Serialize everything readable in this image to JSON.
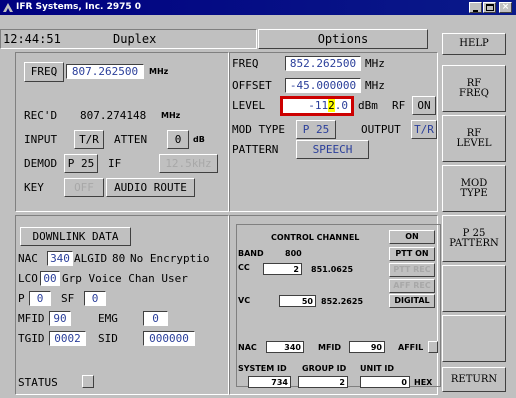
{
  "window": {
    "title": "IFR Systems, Inc. 2975 0",
    "controls": [
      "minimize-icon",
      "maximize-icon",
      "close-icon"
    ]
  },
  "header": {
    "time": "12:44:51",
    "mode": "Duplex",
    "options": "Options",
    "help": "HELP"
  },
  "side_buttons": [
    "RF\nFREQ",
    "RF\nLEVEL",
    "MOD\nTYPE",
    "P 25\nPATTERN",
    "",
    "",
    "RETURN"
  ],
  "left_panel": {
    "freq_label": "FREQ",
    "freq_value": "807.262500",
    "freq_unit": "MHz",
    "recd_label": "REC'D",
    "recd_value": "807.274148",
    "recd_unit": "MHz",
    "input_label": "INPUT",
    "input_value": "T/R",
    "atten_label": "ATTEN",
    "atten_value": "0",
    "atten_unit": "dB",
    "demod_label": "DEMOD",
    "demod_value": "P 25",
    "if_label": "IF",
    "if_value": "12.5kHz",
    "key_label": "KEY",
    "key_value": "OFF",
    "audio_route": "AUDIO ROUTE"
  },
  "right_panel": {
    "freq_label": "FREQ",
    "freq_value": "852.262500",
    "freq_unit": "MHz",
    "offset_label": "OFFSET",
    "offset_value": "-45.000000",
    "offset_unit": "MHz",
    "level_label": "LEVEL",
    "level_before": "-11",
    "level_cursor": "2",
    "level_after": ".0",
    "level_unit": "dBm",
    "rf_label": "RF",
    "rf_value": "ON",
    "modtype_label": "MOD TYPE",
    "modtype_value": "P 25",
    "output_label": "OUTPUT",
    "output_value": "T/R",
    "pattern_label": "PATTERN",
    "pattern_value": "SPEECH"
  },
  "downlink": {
    "title": "DOWNLINK DATA",
    "nac_label": "NAC",
    "nac_value": "340",
    "algid_label": "ALGID",
    "algid_value": "80",
    "algid_desc": "No Encryptio",
    "lco_label": "LCO",
    "lco_value": "00",
    "lco_desc": "Grp Voice Chan User",
    "p_label": "P",
    "p_value": "0",
    "sf_label": "SF",
    "sf_value": "0",
    "mfid_label": "MFID",
    "mfid_value": "90",
    "emg_label": "EMG",
    "emg_value": "0",
    "tgid_label": "TGID",
    "tgid_value": "0002",
    "sid_label": "SID",
    "sid_value": "000000",
    "status_label": "STATUS"
  },
  "control": {
    "title": "CONTROL CHANNEL",
    "state": "ON",
    "band_label": "BAND",
    "band_value": "800",
    "ptt_on": "PTT ON",
    "cc_label": "CC",
    "cc_value": "2",
    "cc_freq": "851.0625",
    "ptt_rec": "PTT REC",
    "aff_rec": "AFF REC",
    "vc_label": "VC",
    "vc_value": "50",
    "vc_freq": "852.2625",
    "digital": "DIGITAL",
    "nac_label": "NAC",
    "nac_value": "340",
    "mfid_label": "MFID",
    "mfid_value": "90",
    "affil_label": "AFFIL",
    "sysid_label": "SYSTEM ID",
    "sysid_value": "734",
    "groupid_label": "GROUP ID",
    "groupid_value": "2",
    "unitid_label": "UNIT ID",
    "unitid_value": "0",
    "hex": "HEX"
  },
  "colors": {
    "title_bar": "#000080",
    "field_text": "#2a3e9a",
    "level_highlight": "#cc0000",
    "cursor_bg": "#ffff00"
  }
}
